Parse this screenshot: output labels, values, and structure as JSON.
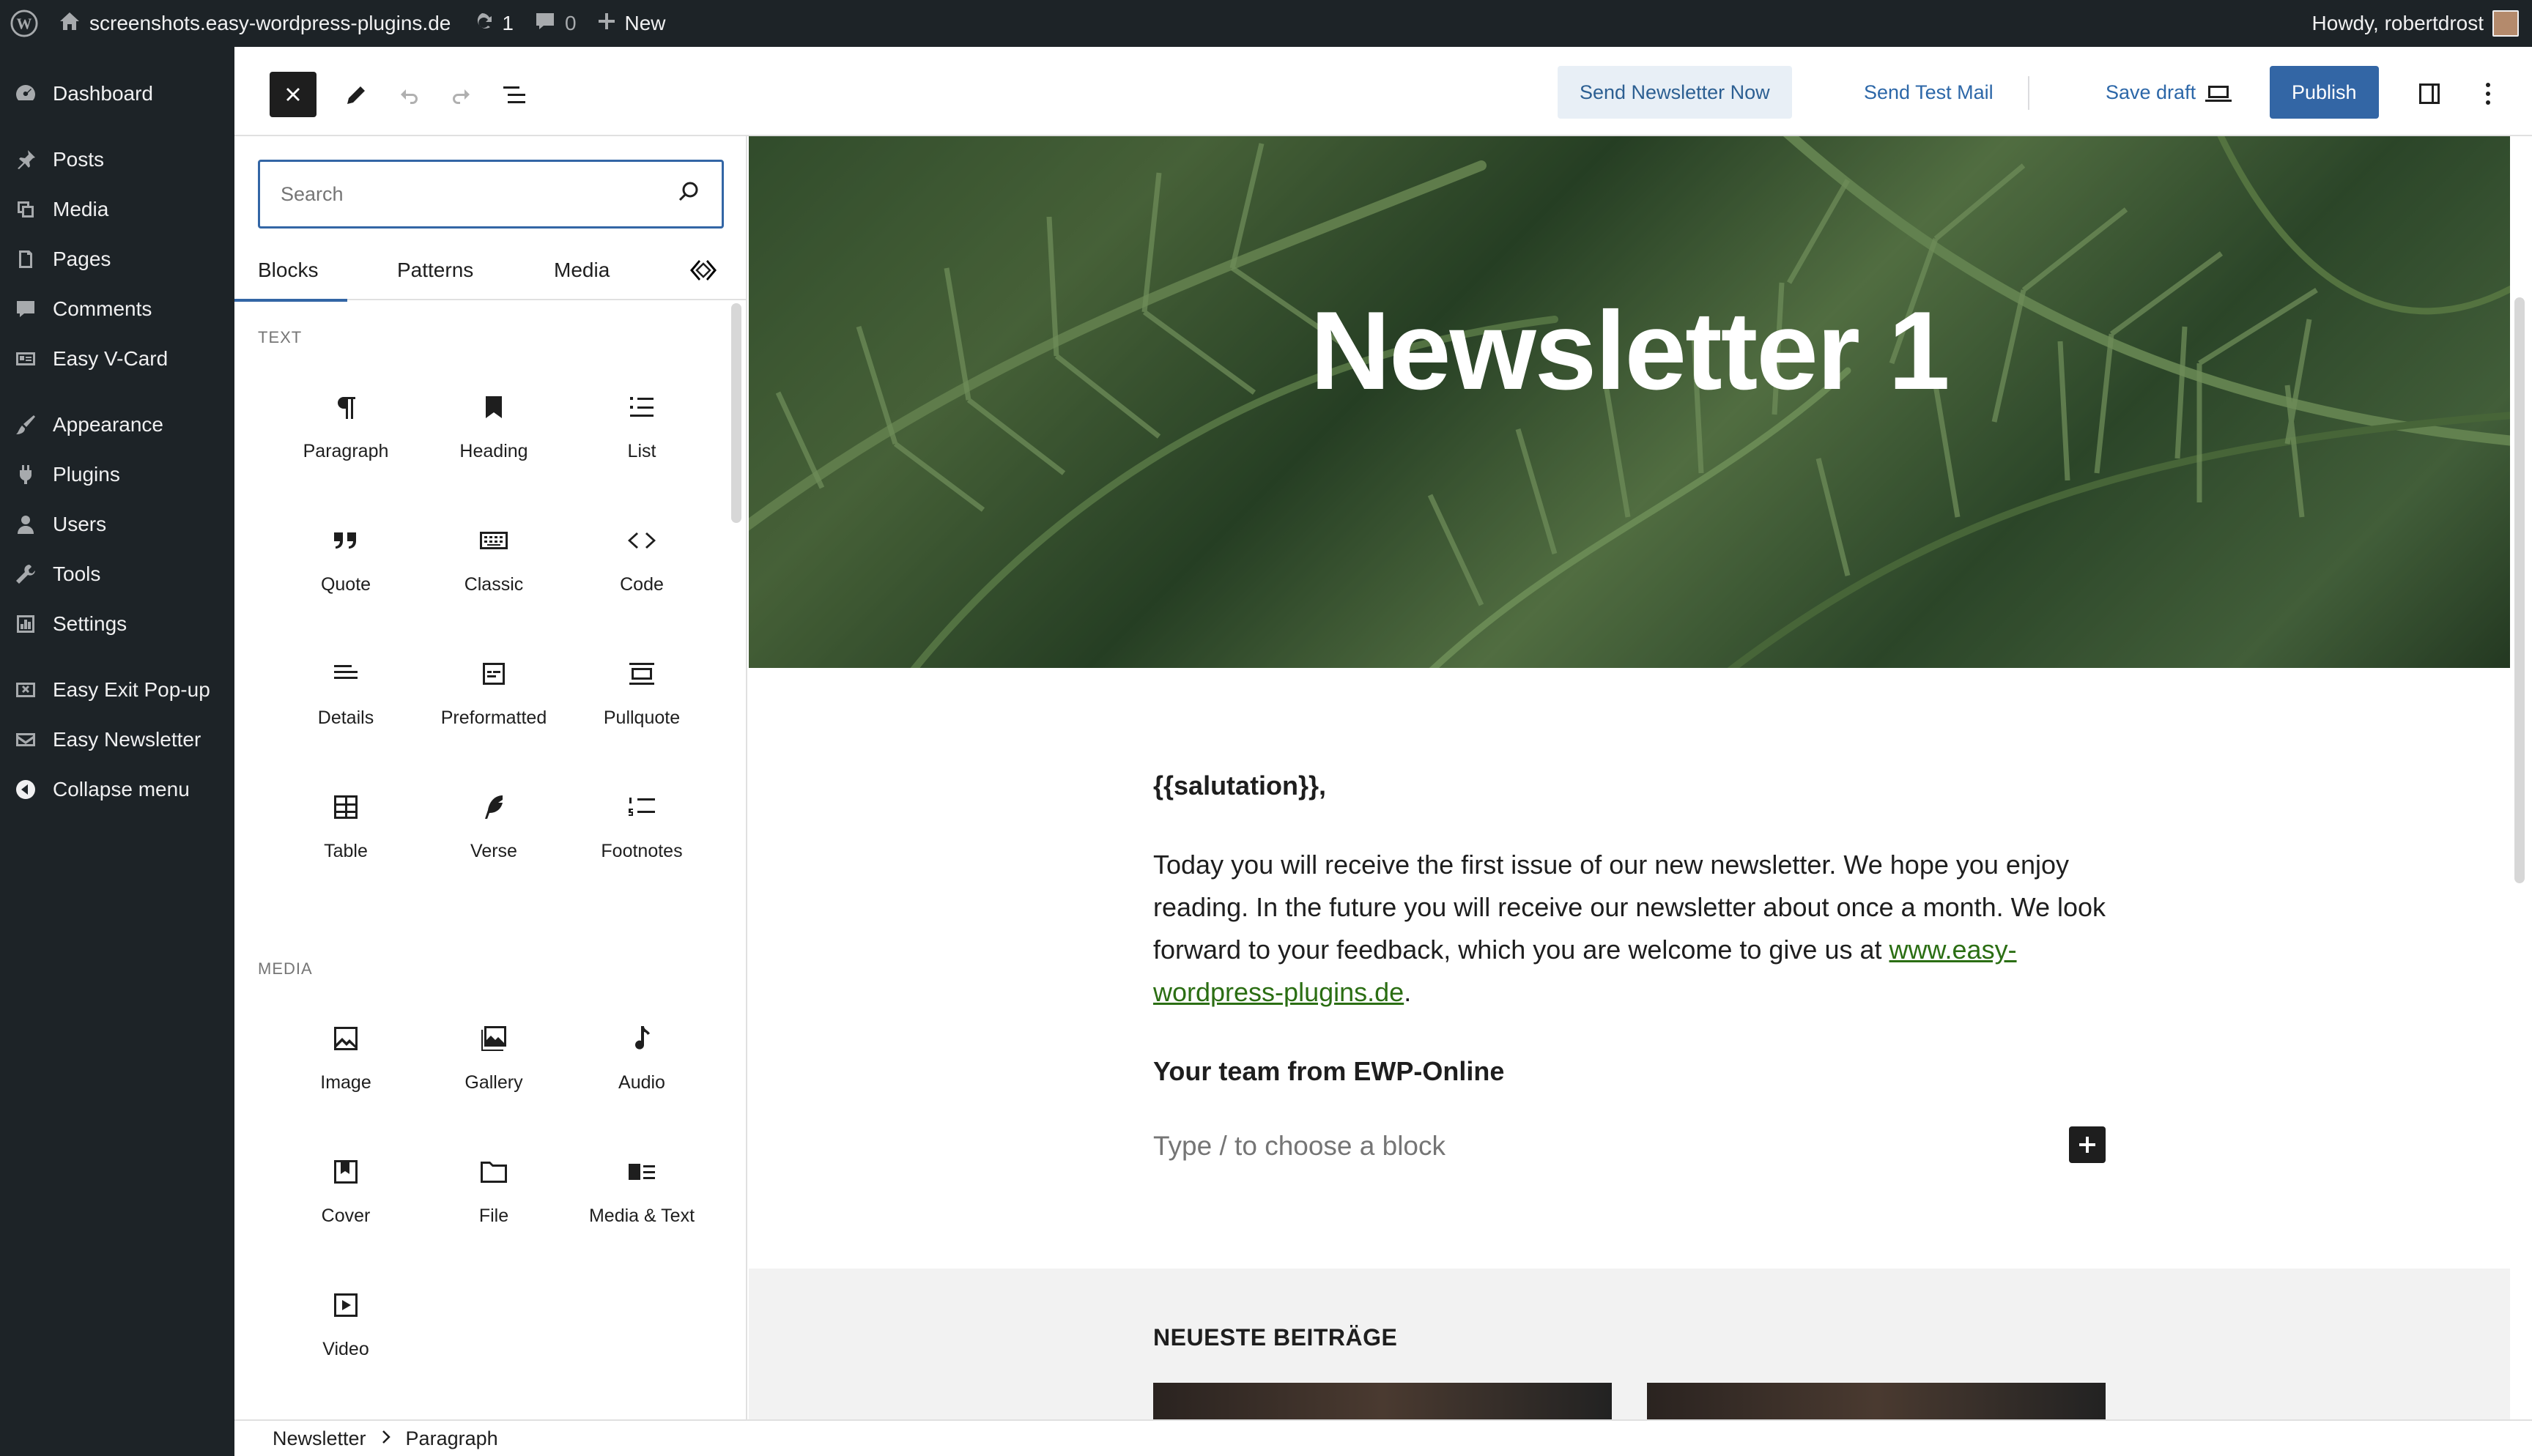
{
  "admin_bar": {
    "site_name": "screenshots.easy-wordpress-plugins.de",
    "updates_count": "1",
    "comments_count": "0",
    "new_label": "New",
    "greeting": "Howdy, robertdrost"
  },
  "admin_menu": {
    "items": [
      {
        "label": "Dashboard",
        "icon": "dashboard-icon"
      },
      {
        "label": "Posts",
        "icon": "pin-icon"
      },
      {
        "label": "Media",
        "icon": "media-icon"
      },
      {
        "label": "Pages",
        "icon": "pages-icon"
      },
      {
        "label": "Comments",
        "icon": "comment-icon"
      },
      {
        "label": "Easy V-Card",
        "icon": "vcard-icon"
      },
      {
        "label": "Appearance",
        "icon": "brush-icon"
      },
      {
        "label": "Plugins",
        "icon": "plug-icon"
      },
      {
        "label": "Users",
        "icon": "user-icon"
      },
      {
        "label": "Tools",
        "icon": "wrench-icon"
      },
      {
        "label": "Settings",
        "icon": "settings-icon"
      },
      {
        "label": "Easy Exit Pop-up",
        "icon": "popup-icon"
      },
      {
        "label": "Easy Newsletter",
        "icon": "envelope-icon"
      },
      {
        "label": "Collapse menu",
        "icon": "collapse-icon"
      }
    ]
  },
  "header": {
    "send_now": "Send Newsletter Now",
    "send_test": "Send Test Mail",
    "save_draft": "Save draft",
    "publish": "Publish"
  },
  "inserter": {
    "search_placeholder": "Search",
    "tabs": [
      "Blocks",
      "Patterns",
      "Media"
    ],
    "text_category": "TEXT",
    "media_category": "MEDIA",
    "text_blocks": [
      "Paragraph",
      "Heading",
      "List",
      "Quote",
      "Classic",
      "Code",
      "Details",
      "Preformatted",
      "Pullquote",
      "Table",
      "Verse",
      "Footnotes"
    ],
    "media_blocks": [
      "Image",
      "Gallery",
      "Audio",
      "Cover",
      "File",
      "Media & Text",
      "Video"
    ]
  },
  "canvas": {
    "cover_title": "Newsletter 1",
    "salutation": "{{salutation}},",
    "paragraph_text": "Today you will receive the first issue of our new newsletter. We hope you enjoy reading. In the future you will receive our newsletter about once a month. We look forward to your feedback, which you are welcome to give us at ",
    "paragraph_link": "www.easy-wordpress-plugins.de",
    "paragraph_end": ".",
    "team_signature": "Your team from EWP-Online",
    "block_placeholder": "Type / to choose a block",
    "latest_title": "NEUESTE BEITRÄGE"
  },
  "footer": {
    "breadcrumb": [
      "Newsletter",
      "Paragraph"
    ]
  },
  "colors": {
    "admin_bg": "#1d2327",
    "accent": "#3366a5",
    "link": "#2b6e13"
  }
}
